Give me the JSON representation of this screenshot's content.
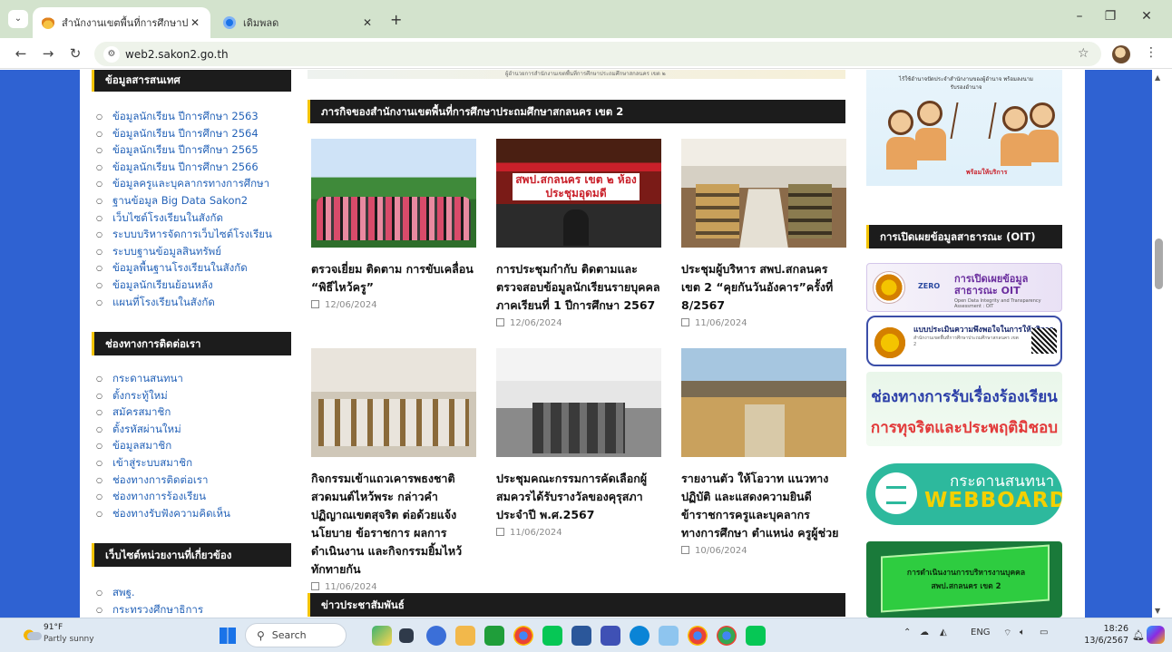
{
  "browser": {
    "tabs": [
      {
        "title": "สำนักงานเขตพื้นที่การศึกษาประถมศึ",
        "close": "✕",
        "active": true
      },
      {
        "title": "เดิมพลด",
        "close": "✕",
        "active": false
      }
    ],
    "new_tab": "+",
    "url": "web2.sakon2.go.th",
    "window_controls": {
      "minimize": "–",
      "restore": "❐",
      "close": "✕"
    }
  },
  "page": {
    "top_banner_caption": "ผู้อำนวยการสำนักงานเขตพื้นที่การศึกษาประถมศึกษาสกลนคร เขต ๒",
    "left_sidebar": {
      "info_title": "ข้อมูลสารสนเทศ",
      "info_links": [
        "ข้อมูลนักเรียน ปีการศึกษา 2563",
        "ข้อมูลนักเรียน ปีการศึกษา 2564",
        "ข้อมูลนักเรียน ปีการศึกษา 2565",
        "ข้อมูลนักเรียน ปีการศึกษา 2566",
        "ข้อมูลครูและบุคลากรทางการศึกษา",
        "ฐานข้อมูล Big Data Sakon2",
        "เว็บไซต์โรงเรียนในสังกัด",
        "ระบบบริหารจัดการเว็บไซต์โรงเรียน",
        "ระบบฐานข้อมูลสินทรัพย์",
        "ข้อมูลพื้นฐานโรงเรียนในสังกัด",
        "ข้อมูลนักเรียนย้อนหลัง",
        "แผนที่โรงเรียนในสังกัด"
      ],
      "contact_title": "ช่องทางการติดต่อเรา",
      "contact_links": [
        "กระดานสนทนา",
        "ตั้งกระทู้ใหม่",
        "สมัครสมาชิก",
        "ตั้งรหัสผ่านใหม่",
        "ข้อมูลสมาชิก",
        "เข้าสู่ระบบสมาชิก",
        "ช่องทางการติดต่อเรา",
        "ช่องทางการร้องเรียน",
        "ช่องทางรับฟังความคิดเห็น"
      ],
      "related_title": "เว็บไซต์หน่วยงานที่เกี่ยวข้อง",
      "related_links": [
        "สพฐ.",
        "กระทรวงศึกษาธิการ"
      ]
    },
    "main": {
      "mission_title": "ภารกิจของสำนักงานเขตพื้นที่การศึกษาประถมศึกษาสกลนคร เขต 2",
      "posts": [
        {
          "headline": "ตรวจเยี่ยม ติดตาม การขับเคลื่อน “พิธีไหว้ครู”",
          "date": "12/06/2024"
        },
        {
          "headline": "การประชุมกำกับ ติดตามและตรวจสอบข้อมูลนักเรียนรายบุคคล ภาคเรียนที่ 1 ปีการศึกษา 2567",
          "date": "12/06/2024",
          "photo_sign": "สพป.สกลนคร เขต ๒ ห้องประชุมอุดมดี"
        },
        {
          "headline": "ประชุมผู้บริหาร สพป.สกลนคร เขต 2 “คุยกันวันอังคาร”ครั้งที่ 8/2567",
          "date": "11/06/2024"
        },
        {
          "headline": "กิจกรรมเข้าแถวเคารพธงชาติ สวดมนต์ไหว้พระ กล่าวคำปฏิญาณเขตสุจริต ต่อด้วยแจ้งนโยบาย ข้อราชการ ผลการดำเนินงาน และกิจกรรมยิ้มไหว้ทักทายกัน",
          "date": "11/06/2024"
        },
        {
          "headline": "ประชุมคณะกรรมการคัดเลือกผู้สมควรได้รับรางวัลของคุรุสภา ประจำปี พ.ศ.2567",
          "date": "11/06/2024"
        },
        {
          "headline": "รายงานตัว ให้โอวาท แนวทางปฏิบัติ และแสดงความยินดีข้าราชการครูและบุคลากรทางการศึกษา ตำแหน่ง ครูผู้ช่วย",
          "date": "10/06/2024"
        }
      ],
      "news_title": "ข่าวประชาสัมพันธ์"
    },
    "right_sidebar": {
      "top_banner_caption": "ไร้ใช้อำนาจปัดประจำสำนักงานของผู้อำนาจ พร้อมลงนามรับรองอำนาจ",
      "top_banner_tag": "พร้อมให้บริการ",
      "oit_title": "การเปิดเผยข้อมูลสาธารณะ (OIT)",
      "oit_banner": {
        "zero": "ZERO",
        "line1": "การเปิดเผยข้อมูล",
        "line2": "สาธารณะ OIT",
        "sub": "Open Data Integrity and Transparency Assessment : OIT"
      },
      "survey_banner": {
        "title": "แบบประเมินความพึงพอใจในการให้บริการ",
        "sub": "สำนักงานเขตพื้นที่การศึกษาประถมศึกษาสกลนคร เขต 2"
      },
      "complaint_banner": {
        "line1": "ช่องทางการรับเรื่องร้องเรียน",
        "line2": "การทุจริตและประพฤติมิชอบ"
      },
      "webboard_banner": {
        "line1": "กระดานสนทนา",
        "line2": "WEBBOARD"
      },
      "hr_banner": "การดำเนินงานการบริหารงานบุคคล สพป.สกลนคร เขต 2"
    }
  },
  "taskbar": {
    "weather": {
      "temp": "91°F",
      "desc": "Partly sunny"
    },
    "search_placeholder": "Search",
    "tray_lang": "ENG",
    "time": "18:26",
    "date": "13/6/2567"
  }
}
